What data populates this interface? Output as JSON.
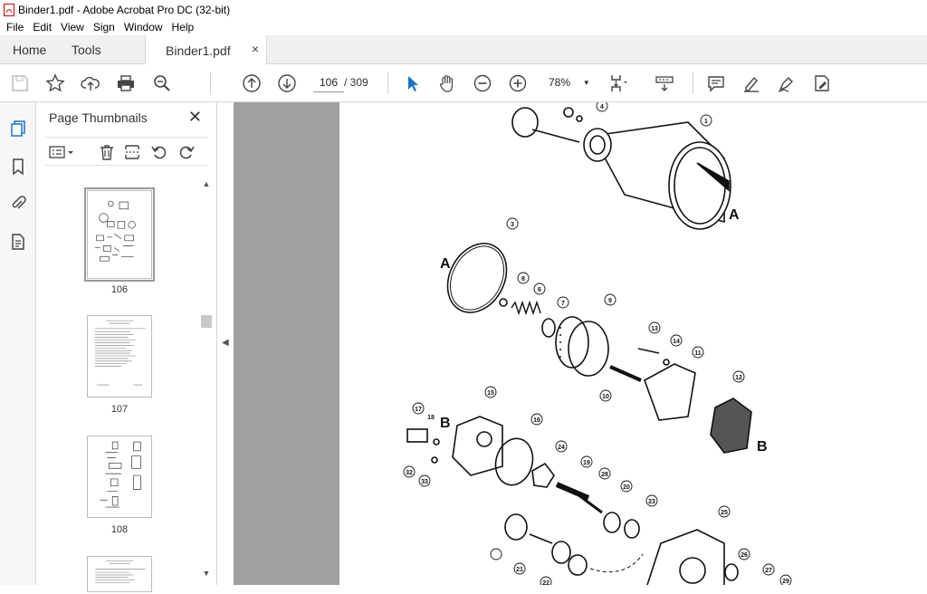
{
  "window": {
    "title": "Binder1.pdf - Adobe Acrobat Pro DC (32-bit)"
  },
  "menu": [
    "File",
    "Edit",
    "View",
    "Sign",
    "Window",
    "Help"
  ],
  "tabs": {
    "home": "Home",
    "tools": "Tools",
    "doc": "Binder1.pdf",
    "close": "×"
  },
  "toolbar": {
    "page_current": "106",
    "page_sep": "/  309",
    "zoom": "78%",
    "zoom_dd": "▾"
  },
  "thumbnails": {
    "title": "Page Thumbnails",
    "close": "✕",
    "pages": [
      "106",
      "107",
      "108"
    ],
    "collapse": "◀",
    "scroll_up": "▲",
    "scroll_down": "▼"
  },
  "diagram": {
    "callouts": [
      "1",
      "3",
      "4",
      "6",
      "7",
      "8",
      "9",
      "10",
      "11",
      "12",
      "13",
      "14",
      "15",
      "16",
      "17",
      "18",
      "19",
      "20",
      "21",
      "22",
      "23",
      "24",
      "25",
      "26",
      "27",
      "28",
      "29",
      "32",
      "33"
    ],
    "letters": [
      "A",
      "A",
      "B",
      "B"
    ]
  }
}
